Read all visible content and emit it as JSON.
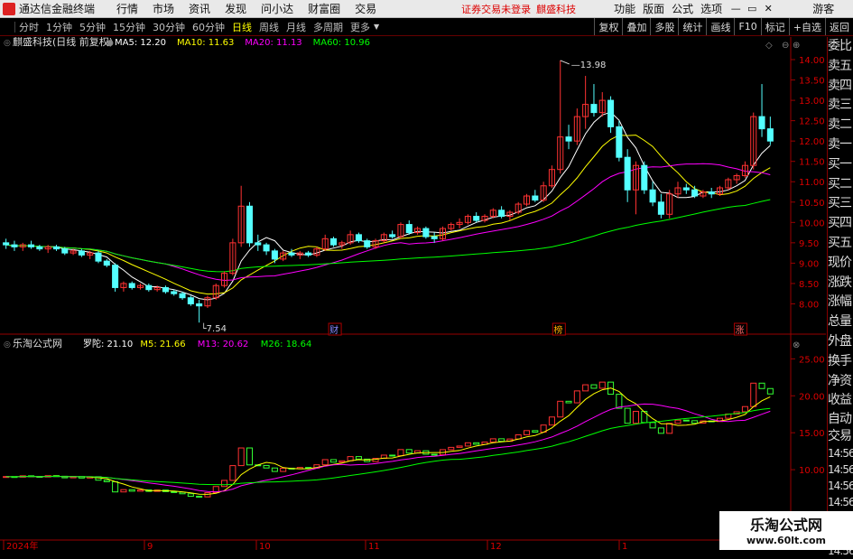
{
  "menubar": {
    "app_title": "通达信金融终端",
    "items": [
      "行情",
      "市场",
      "资讯",
      "发现",
      "问小达",
      "财富圈",
      "交易"
    ],
    "notice": "证券交易未登录",
    "stock_name": "麒盛科技",
    "right_items": [
      "功能",
      "版面",
      "公式",
      "选项"
    ],
    "guest": "游客"
  },
  "tabbar": {
    "tabs": [
      "分时",
      "1分钟",
      "5分钟",
      "15分钟",
      "30分钟",
      "60分钟",
      "日线",
      "周线",
      "月线",
      "多周期",
      "更多"
    ],
    "active": "日线",
    "right": [
      "复权",
      "叠加",
      "多股",
      "统计",
      "画线",
      "F10",
      "标记",
      "+自选",
      "返回"
    ]
  },
  "main": {
    "title": "麒盛科技(日线 前复权)",
    "ma": [
      {
        "label": "MA5: 12.20",
        "color": "#ffffff"
      },
      {
        "label": "MA10: 11.63",
        "color": "#ffff00"
      },
      {
        "label": "MA20: 11.13",
        "color": "#ff00ff"
      },
      {
        "label": "MA60: 10.96",
        "color": "#00ff00"
      }
    ],
    "y_ticks": [
      "14.00",
      "13.50",
      "13.00",
      "12.50",
      "12.00",
      "11.50",
      "11.00",
      "10.50",
      "10.00",
      "9.50",
      "9.00",
      "8.50",
      "8.00"
    ],
    "high_label": "13.98",
    "low_label": "7.54",
    "events": [
      {
        "text": "财"
      },
      {
        "text": "榜"
      },
      {
        "text": "涨"
      }
    ]
  },
  "sub": {
    "title": "乐淘公式网",
    "ind": [
      {
        "label": "罗陀: 21.10",
        "color": "#ffffff"
      },
      {
        "label": "M5: 21.66",
        "color": "#ffff00"
      },
      {
        "label": "M13: 20.62",
        "color": "#ff00ff"
      },
      {
        "label": "M26: 18.64",
        "color": "#00ff00"
      }
    ],
    "y_ticks": [
      "25.00",
      "20.00",
      "15.00",
      "10.00"
    ]
  },
  "x_labels": [
    "2024年",
    "9",
    "10",
    "11",
    "12",
    "1"
  ],
  "right_panel": [
    "委比",
    "卖五",
    "卖四",
    "卖三",
    "卖二",
    "卖一",
    "买一",
    "买二",
    "买三",
    "买四",
    "买五",
    "现价",
    "涨跌",
    "涨幅",
    "总量",
    "外盘",
    "换手",
    "净资",
    "收益",
    "自动",
    "交易",
    "14:56",
    "14:56",
    "14:56",
    "14:56",
    "14:56",
    "14:56",
    "14:56"
  ],
  "watermark": {
    "line1": "乐淘公式网",
    "line2": "www.60lt.com"
  },
  "chart_data": {
    "type": "candlestick",
    "price_ohlc": [
      [
        9.5,
        9.6,
        9.35,
        9.45
      ],
      [
        9.45,
        9.55,
        9.3,
        9.4
      ],
      [
        9.4,
        9.5,
        9.3,
        9.45
      ],
      [
        9.45,
        9.55,
        9.35,
        9.4
      ],
      [
        9.4,
        9.45,
        9.3,
        9.35
      ],
      [
        9.35,
        9.45,
        9.25,
        9.4
      ],
      [
        9.4,
        9.45,
        9.3,
        9.35
      ],
      [
        9.35,
        9.4,
        9.2,
        9.25
      ],
      [
        9.25,
        9.35,
        9.2,
        9.3
      ],
      [
        9.3,
        9.35,
        9.15,
        9.2
      ],
      [
        9.2,
        9.3,
        9.1,
        9.25
      ],
      [
        9.25,
        9.3,
        9.0,
        9.05
      ],
      [
        9.05,
        9.1,
        8.9,
        8.95
      ],
      [
        8.95,
        9.0,
        8.3,
        8.4
      ],
      [
        8.4,
        8.55,
        8.3,
        8.5
      ],
      [
        8.5,
        8.55,
        8.35,
        8.4
      ],
      [
        8.4,
        8.5,
        8.35,
        8.45
      ],
      [
        8.45,
        8.5,
        8.3,
        8.35
      ],
      [
        8.35,
        8.45,
        8.3,
        8.4
      ],
      [
        8.4,
        8.45,
        8.25,
        8.3
      ],
      [
        8.3,
        8.35,
        8.2,
        8.25
      ],
      [
        8.25,
        8.3,
        8.1,
        8.15
      ],
      [
        8.15,
        8.2,
        7.95,
        8.0
      ],
      [
        8.0,
        8.1,
        7.54,
        7.95
      ],
      [
        7.95,
        8.2,
        7.9,
        8.15
      ],
      [
        8.15,
        8.5,
        8.1,
        8.45
      ],
      [
        8.45,
        8.8,
        8.4,
        8.75
      ],
      [
        8.75,
        9.6,
        8.7,
        9.5
      ],
      [
        9.5,
        10.9,
        9.4,
        10.4
      ],
      [
        10.4,
        10.5,
        9.4,
        9.5
      ],
      [
        9.5,
        9.7,
        9.3,
        9.45
      ],
      [
        9.45,
        9.5,
        9.2,
        9.3
      ],
      [
        9.3,
        9.35,
        9.0,
        9.1
      ],
      [
        9.1,
        9.3,
        9.05,
        9.25
      ],
      [
        9.25,
        9.35,
        9.15,
        9.2
      ],
      [
        9.2,
        9.3,
        9.1,
        9.25
      ],
      [
        9.25,
        9.3,
        9.15,
        9.2
      ],
      [
        9.2,
        9.4,
        9.15,
        9.35
      ],
      [
        9.35,
        9.7,
        9.3,
        9.6
      ],
      [
        9.6,
        9.65,
        9.4,
        9.45
      ],
      [
        9.45,
        9.55,
        9.35,
        9.5
      ],
      [
        9.5,
        9.8,
        9.45,
        9.7
      ],
      [
        9.7,
        9.75,
        9.5,
        9.55
      ],
      [
        9.55,
        9.6,
        9.35,
        9.4
      ],
      [
        9.4,
        9.6,
        9.35,
        9.55
      ],
      [
        9.55,
        9.75,
        9.5,
        9.7
      ],
      [
        9.7,
        9.8,
        9.6,
        9.65
      ],
      [
        9.65,
        10.0,
        9.6,
        9.95
      ],
      [
        9.95,
        10.05,
        9.7,
        9.75
      ],
      [
        9.75,
        9.9,
        9.7,
        9.85
      ],
      [
        9.85,
        9.9,
        9.6,
        9.65
      ],
      [
        9.65,
        9.75,
        9.5,
        9.6
      ],
      [
        9.6,
        9.9,
        9.55,
        9.85
      ],
      [
        9.85,
        10.0,
        9.8,
        9.95
      ],
      [
        9.95,
        10.1,
        9.85,
        10.0
      ],
      [
        10.0,
        10.2,
        9.95,
        10.15
      ],
      [
        10.15,
        10.25,
        10.0,
        10.05
      ],
      [
        10.05,
        10.2,
        10.0,
        10.15
      ],
      [
        10.15,
        10.35,
        10.1,
        10.3
      ],
      [
        10.3,
        10.4,
        10.1,
        10.15
      ],
      [
        10.15,
        10.3,
        10.05,
        10.25
      ],
      [
        10.25,
        10.5,
        10.2,
        10.45
      ],
      [
        10.45,
        10.7,
        10.4,
        10.65
      ],
      [
        10.65,
        10.8,
        10.5,
        10.55
      ],
      [
        10.55,
        11.0,
        10.5,
        10.9
      ],
      [
        10.9,
        11.4,
        10.85,
        11.3
      ],
      [
        11.3,
        13.98,
        11.2,
        12.1
      ],
      [
        12.1,
        12.4,
        11.8,
        12.0
      ],
      [
        12.0,
        12.8,
        11.9,
        12.6
      ],
      [
        12.6,
        13.6,
        12.3,
        12.9
      ],
      [
        12.9,
        13.4,
        12.6,
        12.7
      ],
      [
        12.7,
        13.2,
        12.6,
        13.0
      ],
      [
        13.0,
        13.1,
        12.2,
        12.35
      ],
      [
        12.35,
        12.5,
        11.5,
        11.6
      ],
      [
        11.6,
        11.8,
        10.5,
        10.8
      ],
      [
        10.8,
        11.5,
        10.2,
        11.4
      ],
      [
        11.4,
        11.5,
        10.7,
        10.8
      ],
      [
        10.8,
        11.0,
        10.4,
        10.5
      ],
      [
        10.5,
        10.7,
        10.1,
        10.2
      ],
      [
        10.2,
        10.8,
        10.1,
        10.7
      ],
      [
        10.7,
        11.0,
        10.6,
        10.85
      ],
      [
        10.85,
        10.95,
        10.7,
        10.8
      ],
      [
        10.8,
        10.9,
        10.6,
        10.65
      ],
      [
        10.65,
        10.8,
        10.6,
        10.75
      ],
      [
        10.75,
        10.85,
        10.6,
        10.7
      ],
      [
        10.7,
        10.9,
        10.65,
        10.85
      ],
      [
        10.85,
        11.1,
        10.8,
        11.05
      ],
      [
        11.05,
        11.2,
        10.95,
        11.15
      ],
      [
        11.15,
        11.5,
        11.1,
        11.4
      ],
      [
        11.4,
        12.7,
        11.3,
        12.6
      ],
      [
        12.6,
        13.4,
        12.1,
        12.3
      ],
      [
        12.3,
        12.6,
        11.9,
        12.0
      ]
    ],
    "y_range": [
      7.5,
      14.2
    ],
    "sub_range": [
      5,
      27
    ]
  }
}
